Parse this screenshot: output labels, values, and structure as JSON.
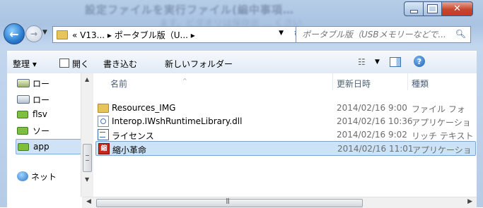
{
  "window": {
    "title_blur": "設定ファイルを実行ファイル(編中事項…",
    "title_blur2": "ます。ビダオリは保存出 … くさい"
  },
  "nav": {
    "address_path": "« V13... ▸ ポータブル版（U... ▸",
    "search_placeholder": "ポータブル版（USBメモリーなどで..."
  },
  "toolbar": {
    "organize": "整理 ▾",
    "open": "開く",
    "burn": "書き込む",
    "new_folder": "新しいフォルダー"
  },
  "navpane": {
    "items": [
      {
        "label": "ロー",
        "icon": "local-drive-icon"
      },
      {
        "label": "ロー",
        "icon": "drive-icon"
      },
      {
        "label": "flsv",
        "icon": "network-drive-icon"
      },
      {
        "label": "ソー",
        "icon": "network-drive-icon"
      },
      {
        "label": "app",
        "icon": "network-drive-icon"
      },
      {
        "label": "ネット",
        "icon": "network-icon"
      }
    ]
  },
  "columns": {
    "name": "名前",
    "date": "更新日時",
    "type": "種類"
  },
  "files": [
    {
      "name": "Resources_IMG",
      "date": "2014/02/16 9:00",
      "type": "ファイル フォ",
      "icon": "folder-icon"
    },
    {
      "name": "Interop.IWshRuntimeLibrary.dll",
      "date": "2014/02/16 10:36",
      "type": "アプリケーショ",
      "icon": "dll-file-icon"
    },
    {
      "name": "ライセンス",
      "date": "2014/02/16 9:02",
      "type": "リッチ テキスト",
      "icon": "rtf-file-icon"
    },
    {
      "name": "縮小革命",
      "date": "2014/02/16 11:01",
      "type": "アプリケーショ",
      "icon": "app-file-icon",
      "selected": true
    }
  ]
}
